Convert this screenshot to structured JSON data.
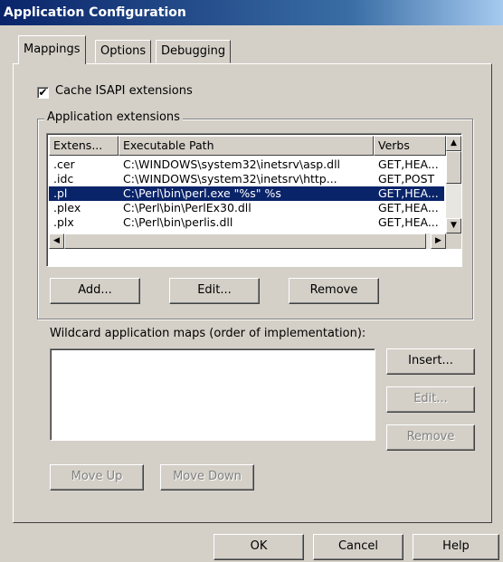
{
  "window": {
    "title": "Application Configuration"
  },
  "tabs": [
    {
      "label": "Mappings",
      "active": true
    },
    {
      "label": "Options",
      "active": false
    },
    {
      "label": "Debugging",
      "active": false
    }
  ],
  "cache_checkbox": {
    "label": "Cache ISAPI extensions",
    "checked": true,
    "check_glyph": "✔"
  },
  "app_extensions": {
    "legend": "Application extensions",
    "columns": [
      "Extens...",
      "Executable Path",
      "Verbs"
    ],
    "rows": [
      {
        "ext": ".cer",
        "path": "C:\\WINDOWS\\system32\\inetsrv\\asp.dll",
        "verbs": "GET,HEA...",
        "selected": false
      },
      {
        "ext": ".idc",
        "path": "C:\\WINDOWS\\system32\\inetsrv\\http...",
        "verbs": "GET,POST",
        "selected": false
      },
      {
        "ext": ".pl",
        "path": "C:\\Perl\\bin\\perl.exe \"%s\" %s",
        "verbs": "GET,HEA...",
        "selected": true
      },
      {
        "ext": ".plex",
        "path": "C:\\Perl\\bin\\PerlEx30.dll",
        "verbs": "GET,HEA...",
        "selected": false
      },
      {
        "ext": ".plx",
        "path": "C:\\Perl\\bin\\perlis.dll",
        "verbs": "GET,HEA...",
        "selected": false
      }
    ],
    "buttons": {
      "add": "Add...",
      "edit": "Edit...",
      "remove": "Remove"
    }
  },
  "wildcard": {
    "label": "Wildcard application maps (order of implementation):",
    "buttons": {
      "insert": "Insert...",
      "edit": "Edit...",
      "remove": "Remove"
    },
    "move_up": "Move Up",
    "move_down": "Move Down"
  },
  "dialog_buttons": {
    "ok": "OK",
    "cancel": "Cancel",
    "help": "Help"
  }
}
